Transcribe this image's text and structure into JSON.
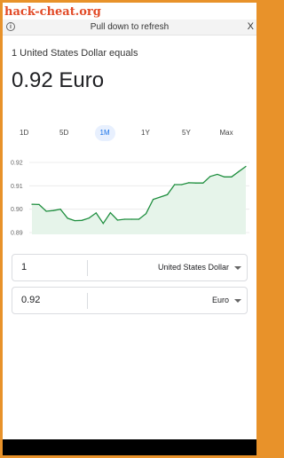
{
  "watermark": "hack-cheat.org",
  "topbar": {
    "info_icon": "i",
    "message": "Pull down to refresh",
    "close_label": "X"
  },
  "conversion": {
    "equals_text": "1 United States Dollar equals",
    "result_text": "0.92 Euro"
  },
  "ranges": [
    {
      "label": "1D",
      "active": false
    },
    {
      "label": "5D",
      "active": false
    },
    {
      "label": "1M",
      "active": true
    },
    {
      "label": "1Y",
      "active": false
    },
    {
      "label": "5Y",
      "active": false
    },
    {
      "label": "Max",
      "active": false
    }
  ],
  "chart_data": {
    "type": "area",
    "y_ticks": [
      "0.92",
      "0.91",
      "0.90",
      "0.89"
    ],
    "ylim": [
      0.89,
      0.92
    ],
    "values": [
      0.9021,
      0.902,
      0.8991,
      0.8994,
      0.9,
      0.8961,
      0.8951,
      0.8952,
      0.8962,
      0.8984,
      0.8939,
      0.8985,
      0.8953,
      0.8957,
      0.8957,
      0.8957,
      0.8981,
      0.9042,
      0.9052,
      0.9062,
      0.9105,
      0.9105,
      0.9113,
      0.9112,
      0.9112,
      0.914,
      0.9149,
      0.9138,
      0.9138,
      0.9161,
      0.9183
    ],
    "line_color": "#1e8e3e",
    "fill_color": "#e6f4ea",
    "grid": true
  },
  "converter": {
    "from_amount": "1",
    "from_currency": "United States Dollar",
    "to_amount": "0.92",
    "to_currency": "Euro"
  }
}
